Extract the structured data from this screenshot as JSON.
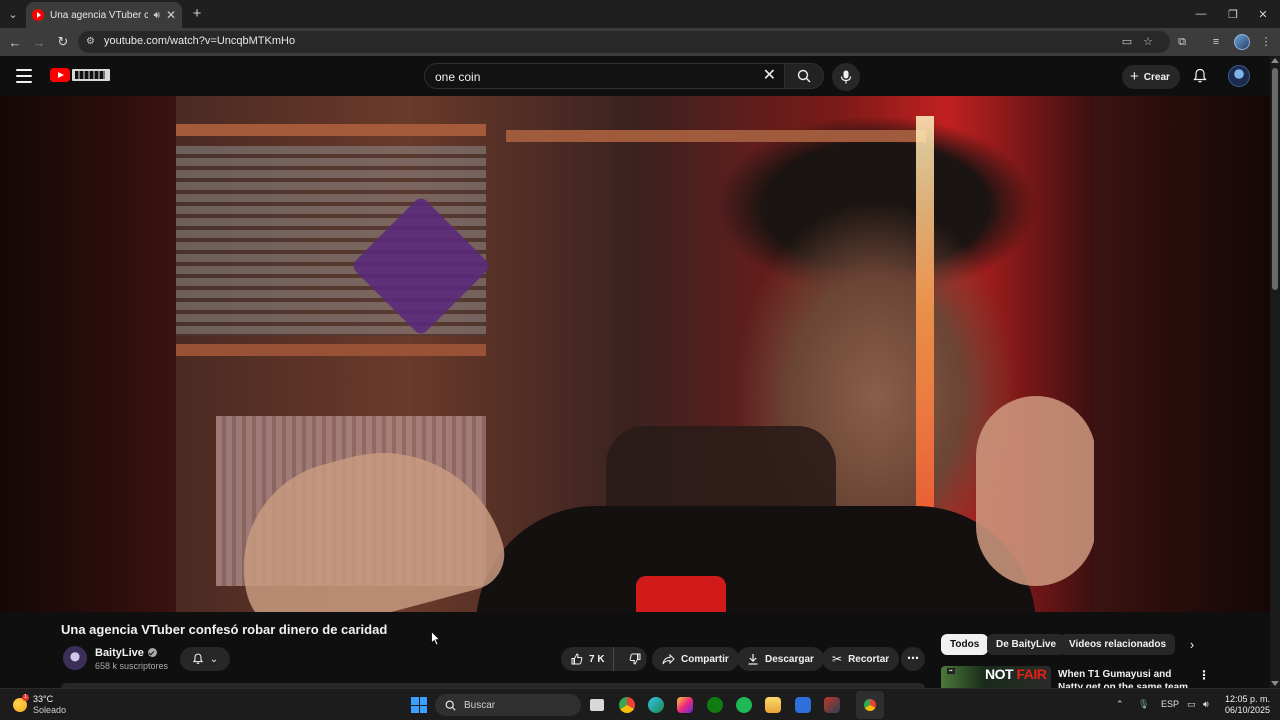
{
  "browser": {
    "tab_title": "Una agencia VTuber confesó robar dinero de caridad",
    "url": "youtube.com/watch?v=UncqbMTKmHo"
  },
  "youtube": {
    "search_query": "one coin",
    "create_label": "Crear"
  },
  "video": {
    "title": "Una agencia VTuber confesó robar dinero de caridad",
    "channel_name": "BaityLive",
    "subscribers": "658 k suscriptores",
    "like_count": "7 K",
    "share_label": "Compartir",
    "download_label": "Descargar",
    "clip_label": "Recortar"
  },
  "related": {
    "chips": [
      "Todos",
      "De BaityLive",
      "Videos relacionados"
    ],
    "first_video_title": "When T1 Gumayusi and Natty get on the same team",
    "first_thumb_text_a": "NOT",
    "first_thumb_text_b": "FAIR"
  },
  "taskbar": {
    "temperature": "33°C",
    "weather": "Soleado",
    "search_label": "Buscar",
    "language": "ESP",
    "time": "12:05 p. m.",
    "date": "06/10/2025",
    "weather_badge": "1"
  },
  "colors": {
    "youtube_red": "#ff0000",
    "background": "#0f0f0f",
    "chip_active": "#f1f1f1"
  }
}
